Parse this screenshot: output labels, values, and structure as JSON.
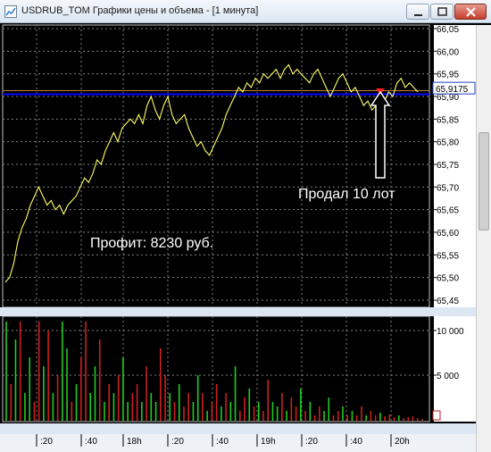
{
  "window": {
    "title": "USDRUB_TOM Графики цены и объема - [1 минута]",
    "colors": {
      "price_line": "#ffff66",
      "grid": "#808080",
      "level": "#0000ff",
      "sell_marker": "#ff2020",
      "volume_up": "#22cc22",
      "volume_down": "#cc2020"
    }
  },
  "annotations": {
    "sold": "Продал 10 лот",
    "profit": "Профит: 8230 руб."
  },
  "chart_data": [
    {
      "type": "line",
      "name": "price",
      "yticks": [
        "66,05",
        "66,00",
        "65,95",
        "65,90",
        "65,85",
        "65,80",
        "65,75",
        "65,70",
        "65,65",
        "65,60",
        "65,55",
        "65,50",
        "65,45"
      ],
      "ylim": [
        65.45,
        66.05
      ],
      "current_price_label": "65,9175",
      "current_price": 65.9175,
      "level": 65.905,
      "values": [
        65.49,
        65.5,
        65.53,
        65.58,
        65.61,
        65.63,
        65.66,
        65.68,
        65.7,
        65.68,
        65.66,
        65.67,
        65.65,
        65.66,
        65.64,
        65.66,
        65.67,
        65.68,
        65.7,
        65.72,
        65.71,
        65.73,
        65.76,
        65.75,
        65.78,
        65.8,
        65.82,
        65.8,
        65.83,
        65.84,
        65.85,
        65.84,
        65.86,
        65.84,
        65.88,
        65.9,
        65.87,
        65.85,
        65.88,
        65.9,
        65.86,
        65.84,
        65.85,
        65.86,
        65.83,
        65.81,
        65.79,
        65.8,
        65.78,
        65.77,
        65.79,
        65.81,
        65.83,
        65.86,
        65.88,
        65.9,
        65.92,
        65.91,
        65.93,
        65.92,
        65.94,
        65.93,
        65.95,
        65.94,
        65.95,
        65.96,
        65.94,
        65.96,
        65.97,
        65.95,
        65.96,
        65.95,
        65.94,
        65.93,
        65.95,
        65.96,
        65.94,
        65.92,
        65.9,
        65.92,
        65.94,
        65.95,
        65.93,
        65.91,
        65.92,
        65.9,
        65.88,
        65.89,
        65.87,
        65.88,
        65.9,
        65.89,
        65.91,
        65.9,
        65.93,
        65.94,
        65.92,
        65.93,
        65.92,
        65.91
      ]
    },
    {
      "type": "bar",
      "name": "volume",
      "yticks": [
        "10 000",
        "5 000"
      ],
      "ylim": [
        0,
        11000
      ],
      "values": [
        11000,
        4000,
        9000,
        11000,
        3000,
        7000,
        2000,
        11000,
        6000,
        10000,
        3000,
        5000,
        11000,
        8000,
        2000,
        4000,
        7000,
        11000,
        3000,
        6000,
        9000,
        2000,
        4000,
        3000,
        5000,
        7000,
        2000,
        3000,
        4000,
        2000,
        6000,
        3000,
        2000,
        8000,
        5000,
        3000,
        2000,
        4000,
        1500,
        3000,
        2000,
        5000,
        3000,
        1000,
        2000,
        4000,
        1500,
        3000,
        2000,
        6000,
        1000,
        2500,
        3500,
        1500,
        2000,
        1000,
        4500,
        2000,
        1500,
        3000,
        1000,
        2500,
        1500,
        3500,
        1000,
        2000,
        500,
        1500,
        1000,
        2500,
        500,
        1000,
        1500,
        500,
        1000,
        500,
        1500,
        500,
        1000,
        500,
        800,
        400,
        600,
        300,
        500,
        200,
        300,
        400,
        200,
        100
      ],
      "up": [
        1,
        0,
        1,
        0,
        1,
        1,
        0,
        0,
        1,
        0,
        1,
        0,
        1,
        1,
        0,
        1,
        0,
        0,
        1,
        1,
        0,
        1,
        0,
        1,
        0,
        1,
        1,
        0,
        0,
        1,
        0,
        1,
        1,
        0,
        0,
        1,
        0,
        1,
        0,
        0,
        1,
        1,
        0,
        1,
        0,
        0,
        1,
        0,
        1,
        1,
        0,
        0,
        1,
        0,
        1,
        0,
        0,
        1,
        1,
        0,
        1,
        0,
        0,
        1,
        0,
        1,
        0,
        0,
        1,
        1,
        0,
        0,
        1,
        0,
        1,
        0,
        0,
        1,
        0,
        0,
        1,
        0,
        0,
        0,
        1,
        0,
        0,
        0,
        0,
        0
      ]
    }
  ],
  "time_axis": {
    "labels": [
      ":20",
      ":40",
      "18h",
      ":20",
      ":40",
      "19h",
      ":20",
      ":40",
      "20h"
    ]
  }
}
